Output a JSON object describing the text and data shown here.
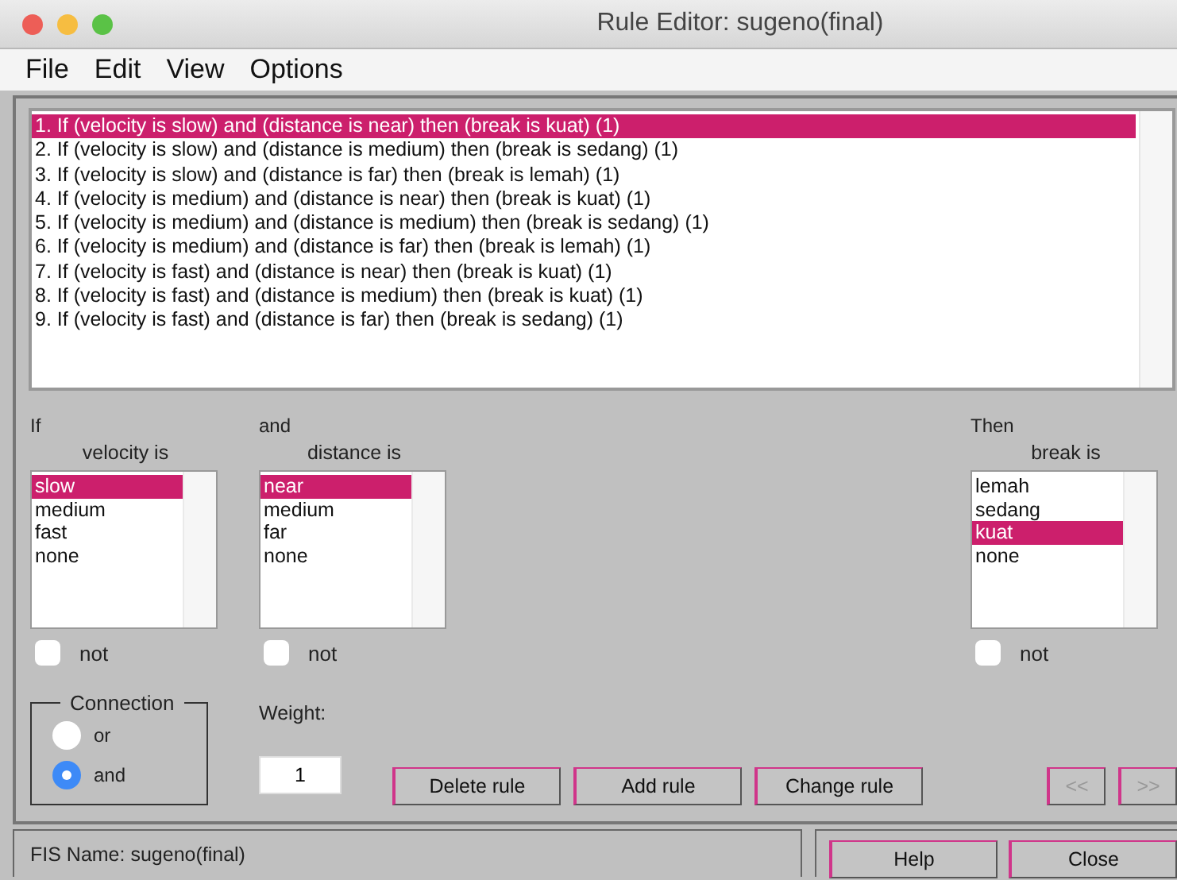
{
  "window": {
    "title": "Rule Editor: sugeno(final)"
  },
  "menu": [
    "File",
    "Edit",
    "View",
    "Options"
  ],
  "rules": [
    {
      "text": "1. If (velocity is slow) and (distance is near) then (break is kuat) (1)",
      "selected": true
    },
    {
      "text": "2. If (velocity is slow) and (distance is medium) then (break is sedang) (1)",
      "selected": false
    },
    {
      "text": "3. If (velocity is slow) and (distance is far) then (break is lemah) (1)",
      "selected": false
    },
    {
      "text": "4. If (velocity is medium) and (distance is near) then (break is kuat) (1)",
      "selected": false
    },
    {
      "text": "5. If (velocity is medium) and (distance is medium) then (break is sedang) (1)",
      "selected": false
    },
    {
      "text": "6. If (velocity is medium) and (distance is far) then (break is lemah) (1)",
      "selected": false
    },
    {
      "text": "7. If (velocity is fast) and (distance is near) then (break is kuat) (1)",
      "selected": false
    },
    {
      "text": "8. If (velocity is fast) and (distance is medium) then (break is kuat) (1)",
      "selected": false
    },
    {
      "text": "9. If (velocity is fast) and (distance is far) then (break is sedang) (1)",
      "selected": false
    }
  ],
  "variables": [
    {
      "heading": "If",
      "label": "velocity is",
      "not": {
        "label": "not",
        "checked": false
      },
      "options": [
        {
          "text": "slow",
          "selected": true
        },
        {
          "text": "medium",
          "selected": false
        },
        {
          "text": "fast",
          "selected": false
        },
        {
          "text": "none",
          "selected": false
        }
      ]
    },
    {
      "heading": "and",
      "label": "distance is",
      "not": {
        "label": "not",
        "checked": false
      },
      "options": [
        {
          "text": "near",
          "selected": true
        },
        {
          "text": "medium",
          "selected": false
        },
        {
          "text": "far",
          "selected": false
        },
        {
          "text": "none",
          "selected": false
        }
      ]
    },
    {
      "heading": "Then",
      "label": "break is",
      "not": {
        "label": "not",
        "checked": false
      },
      "options": [
        {
          "text": "lemah",
          "selected": false
        },
        {
          "text": "sedang",
          "selected": false
        },
        {
          "text": "kuat",
          "selected": true
        },
        {
          "text": "none",
          "selected": false
        }
      ]
    }
  ],
  "connection": {
    "title": "Connection",
    "options": [
      {
        "label": "or",
        "selected": false
      },
      {
        "label": "and",
        "selected": true
      }
    ]
  },
  "weight": {
    "label": "Weight:",
    "value": "1"
  },
  "rule_buttons": [
    "Delete rule",
    "Add rule",
    "Change rule"
  ],
  "nav_buttons": [
    {
      "label": "<<",
      "disabled": true
    },
    {
      "label": ">>",
      "disabled": true
    }
  ],
  "status": "FIS Name: sugeno(final)",
  "footer_buttons": [
    "Help",
    "Close"
  ]
}
